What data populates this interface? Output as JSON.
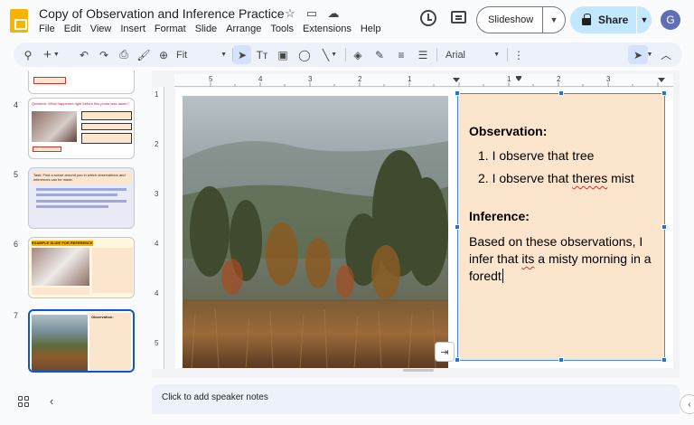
{
  "app": {
    "title": "Copy of Observation and Inference Practice",
    "menu": [
      "File",
      "Edit",
      "View",
      "Insert",
      "Format",
      "Slide",
      "Arrange",
      "Tools",
      "Extensions",
      "Help"
    ],
    "slideshow_label": "Slideshow",
    "share_label": "Share",
    "avatar_letter": "G"
  },
  "toolbar": {
    "zoom": "Fit",
    "font": "Arial"
  },
  "filmstrip": {
    "slides": [
      {
        "num": "4",
        "title": "Question: What happened right before this photo was taken?"
      },
      {
        "num": "5",
        "title": "Task: Find a scene around you in which observations and inferences can be made."
      },
      {
        "num": "6",
        "title": "EXAMPLE SLIDE FOR REFERENCE"
      },
      {
        "num": "7",
        "title": "Observation:"
      }
    ]
  },
  "textbox": {
    "observation_heading": "Observation:",
    "observations": [
      "1. I observe that tree",
      "2. I observe that theres mist"
    ],
    "inference_heading": "Inference:",
    "inference_body": "Based on these observations, I infer that its a misty morning in a foredt"
  },
  "notes": {
    "placeholder": "Click to add speaker notes"
  },
  "colors": {
    "accent": "#0b57d0",
    "share_bg": "#c2e7ff",
    "textbox_bg": "#fce5cd",
    "toolbar_bg": "#edf2fa"
  }
}
